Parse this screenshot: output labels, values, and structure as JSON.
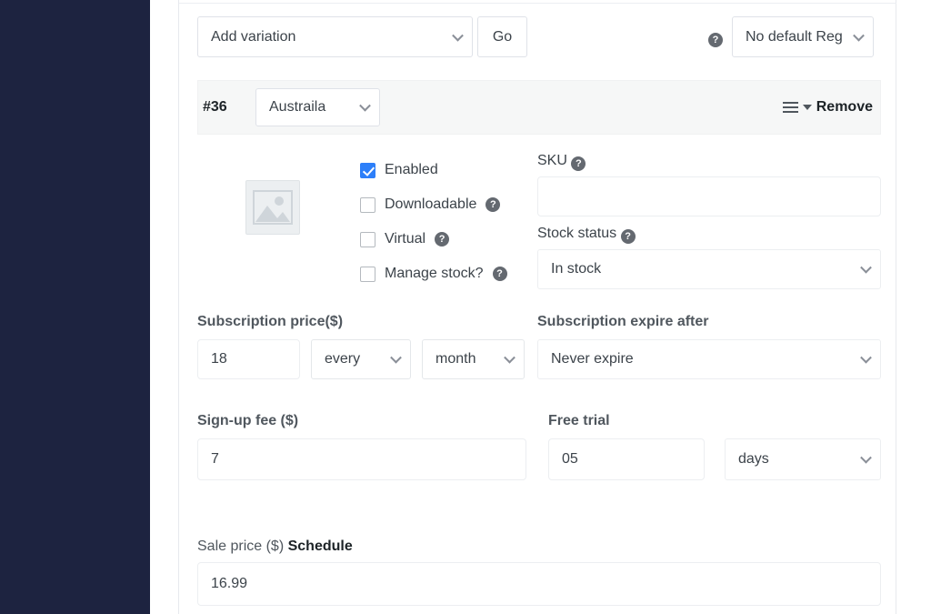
{
  "sidebar": {
    "name": "admin-sidebar"
  },
  "toolbar": {
    "add_variation_value": "Add variation",
    "go_label": "Go",
    "help_glyph": "?",
    "default_region_value": "No default Reg"
  },
  "variation": {
    "id_label": "#36",
    "attribute_value": "Austraila",
    "remove_label": "Remove",
    "checkboxes": [
      {
        "label": "Enabled",
        "checked": true,
        "help": false
      },
      {
        "label": "Downloadable",
        "checked": false,
        "help": true
      },
      {
        "label": "Virtual",
        "checked": false,
        "help": true
      },
      {
        "label": "Manage stock?",
        "checked": false,
        "help": true
      }
    ],
    "sku": {
      "label": "SKU",
      "value": "",
      "placeholder": ""
    },
    "stock_status": {
      "label": "Stock status",
      "value": "In stock"
    }
  },
  "subscription": {
    "price_label": "Subscription price($)",
    "price_value": "18",
    "interval_value": "every",
    "period_value": "month",
    "expire_label": "Subscription expire after",
    "expire_value": "Never expire"
  },
  "signup": {
    "label": "Sign-up fee ($)",
    "value": "7"
  },
  "free_trial": {
    "label": "Free trial",
    "value": "05",
    "unit_value": "days"
  },
  "sale": {
    "label": "Sale price ($)",
    "schedule_label": "Schedule",
    "value": "16.99"
  }
}
